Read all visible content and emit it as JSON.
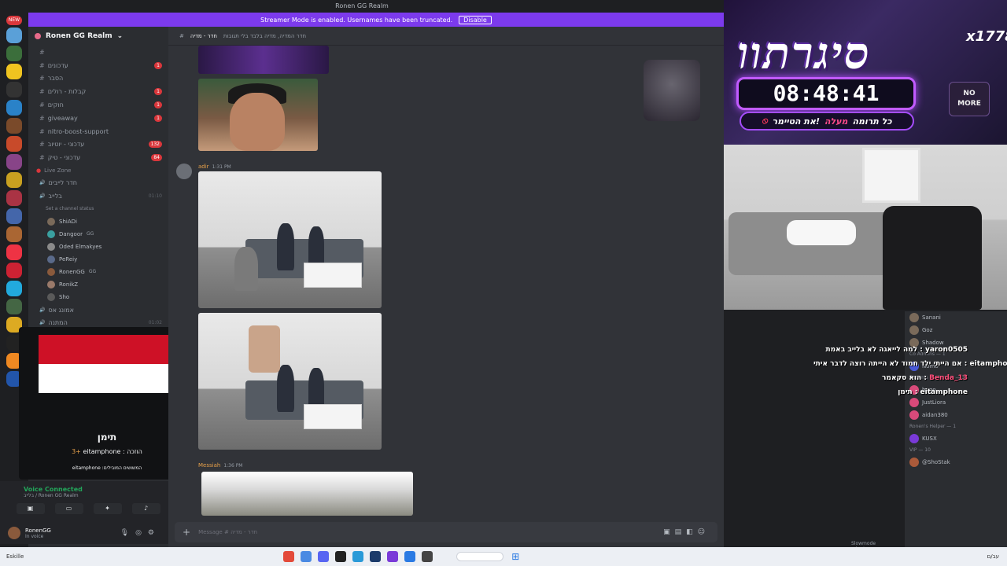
{
  "titlebar": {
    "title": "Ronen GG Realm"
  },
  "streamer_bar": {
    "message": "Streamer Mode is enabled. Usernames have been truncated.",
    "disable_label": "Disable"
  },
  "rail": {
    "new_badge": "NEW",
    "badges": [
      "",
      "",
      "",
      "",
      "",
      "",
      "",
      "",
      "1",
      "",
      "",
      "",
      "",
      "",
      "",
      "",
      "",
      "",
      "",
      "",
      "",
      "",
      ""
    ]
  },
  "server": {
    "name": "Ronen GG Realm"
  },
  "channels": [
    {
      "label": "",
      "count": ""
    },
    {
      "label": "עדכונים",
      "count": "1"
    },
    {
      "label": "הסבר",
      "count": ""
    },
    {
      "label": "קבלות - רולים",
      "count": "1"
    },
    {
      "label": "חוקים",
      "count": "1"
    },
    {
      "label": "giveaway",
      "count": "1"
    },
    {
      "label": "nitro-boost-support",
      "count": ""
    },
    {
      "label": "עדכוני - יוטיוב",
      "count": "132"
    },
    {
      "label": "עדכוני - טיק",
      "count": "84"
    }
  ],
  "live_zone": {
    "label": "Live Zone"
  },
  "voice_channels": [
    {
      "label": "חדר לייבים",
      "time": ""
    },
    {
      "label": "בלייב",
      "time": "01:10"
    }
  ],
  "channel_status": "Set a channel status",
  "voice_users": [
    {
      "name": "ShiADi",
      "tag": ""
    },
    {
      "name": "Dangoor",
      "tag": "GG"
    },
    {
      "name": "Oded Elmakyes",
      "tag": ""
    },
    {
      "name": "PeReiy",
      "tag": ""
    },
    {
      "name": "RonenGG",
      "tag": "GG"
    },
    {
      "name": "RonikZ",
      "tag": ""
    },
    {
      "name": "Sho",
      "tag": ""
    }
  ],
  "lower_channels": [
    {
      "label": "אמונג אס",
      "time": ""
    },
    {
      "label": "המתנה",
      "time": "01:02"
    }
  ],
  "popup": {
    "name": "תימן",
    "line1_prefix": "3+",
    "line1_user": "eitamphone",
    "line1_text": ": הוזכה",
    "line2": "eitamphone :המשושים המובילים"
  },
  "voice_panel": {
    "status": "Voice Connected",
    "sub": "בלייב / Ronen GG Realm"
  },
  "user_panel": {
    "name": "RonenGG",
    "status": "In voice"
  },
  "chat": {
    "header_channel": "חדר - מדיה",
    "header_topic": "חדר המדיה, מדיה בלבד בלי תגובות",
    "msg1_user": "adir",
    "msg1_time": "1:31 PM",
    "msg2_user": "Messiah",
    "msg2_time": "1:36 PM",
    "composer_placeholder": "Message # חדר - מדיה",
    "slowmode": "Slowmode minute"
  },
  "overlay": {
    "logo_text": "סיגרתוו",
    "multiplier": "x1778",
    "timer": "08:48:41",
    "donate_text_pre": "כל תרומה",
    "donate_highlight": "מעלה",
    "donate_text_post": "את הטיימר!",
    "nomore_1": "NO",
    "nomore_2": "MORE"
  },
  "stream_chat": [
    {
      "user": "yaron0505",
      "text": "למה לייאגה לא בלייב באמת"
    },
    {
      "user": "eitamphone",
      "text": "אם הייתי ילד חמוד לא הייתה רוצה לדבר איתי"
    },
    {
      "user": "Benda_13",
      "text": "הוא סקאמר"
    },
    {
      "user": "eitamphone",
      "text": "תימן"
    }
  ],
  "members": {
    "top": [
      "Sanani",
      "Goz",
      "Shadow"
    ],
    "co_admins_label": "Co Admins — 1",
    "co_admins": [
      "Nomo"
    ],
    "mods_label": "Ronen's Moderator — 3",
    "mods": [
      "hugo",
      "JustLiora",
      "aidan380"
    ],
    "helper_label": "Ronen's Helper — 1",
    "helpers": [
      "KUSX"
    ],
    "vip_label": "VIP — 10",
    "vips": [
      "@ShoStak"
    ]
  },
  "taskbar": {
    "left_text": "Eskille",
    "clock": "עב/ם"
  }
}
